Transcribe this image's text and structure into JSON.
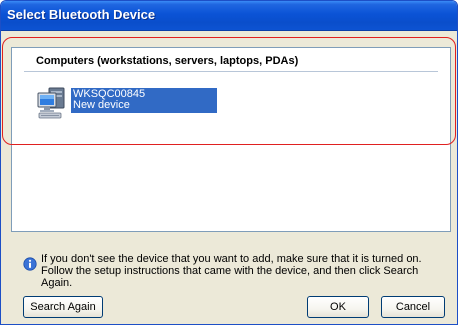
{
  "window": {
    "title": "Select Bluetooth Device"
  },
  "list": {
    "group_title": "Computers (workstations, servers, laptops, PDAs)",
    "devices": [
      {
        "name": "WKSQC00845",
        "status": "New device",
        "icon": "computer-icon"
      }
    ]
  },
  "info": {
    "icon": "info-icon",
    "text": "If you don't see the device that you want to add, make sure that it is turned on. Follow the setup instructions that came with the device, and then click Search Again."
  },
  "buttons": {
    "search_again": "Search Again",
    "ok": "OK",
    "cancel": "Cancel"
  },
  "colors": {
    "title_bar": "#0a4ecb",
    "selection": "#316ac5",
    "annotation": "#e02020"
  }
}
